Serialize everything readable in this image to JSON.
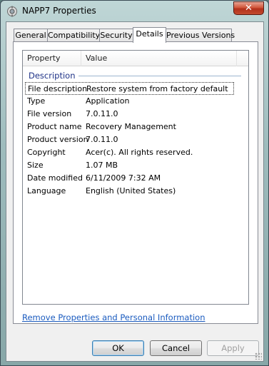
{
  "window": {
    "title": "NAPP7 Properties",
    "close_glyph": "✕"
  },
  "tabs": [
    {
      "label": "General"
    },
    {
      "label": "Compatibility"
    },
    {
      "label": "Security"
    },
    {
      "label": "Details"
    },
    {
      "label": "Previous Versions"
    }
  ],
  "active_tab": "Details",
  "list": {
    "columns": {
      "property": "Property",
      "value": "Value"
    },
    "group": "Description",
    "rows": [
      {
        "property": "File description",
        "value": "Restore system from factory default"
      },
      {
        "property": "Type",
        "value": "Application"
      },
      {
        "property": "File version",
        "value": "7.0.11.0"
      },
      {
        "property": "Product name",
        "value": "Recovery Management"
      },
      {
        "property": "Product version",
        "value": "7.0.11.0"
      },
      {
        "property": "Copyright",
        "value": "Acer(c).  All rights reserved."
      },
      {
        "property": "Size",
        "value": "1.07 MB"
      },
      {
        "property": "Date modified",
        "value": "6/11/2009 7:32 AM"
      },
      {
        "property": "Language",
        "value": "English (United States)"
      }
    ]
  },
  "link": {
    "label": "Remove Properties and Personal Information"
  },
  "buttons": {
    "ok": "OK",
    "cancel": "Cancel",
    "apply": "Apply"
  },
  "icons": {
    "app": "properties-app-icon",
    "close": "close-icon"
  },
  "colors": {
    "link": "#1a5bbf",
    "group_label": "#1e3287",
    "close_button": "#c24a2e"
  }
}
